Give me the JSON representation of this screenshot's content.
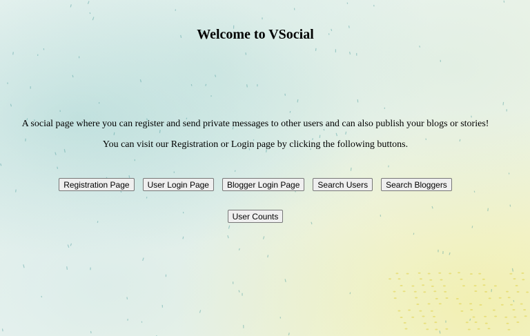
{
  "page": {
    "title": "Welcome to VSocial",
    "description_1": "A social page where you can register and send private messages to other users and can also publish your blogs or stories!",
    "description_2": "You can visit our Registration or Login page by clicking the following buttons."
  },
  "buttons": {
    "registration": "Registration Page",
    "user_login": "User Login Page",
    "blogger_login": "Blogger Login Page",
    "search_users": "Search Users",
    "search_bloggers": "Search Bloggers",
    "user_counts": "User Counts"
  },
  "colors": {
    "button_bg": "#efefef",
    "button_border": "#767676",
    "text": "#000000"
  }
}
